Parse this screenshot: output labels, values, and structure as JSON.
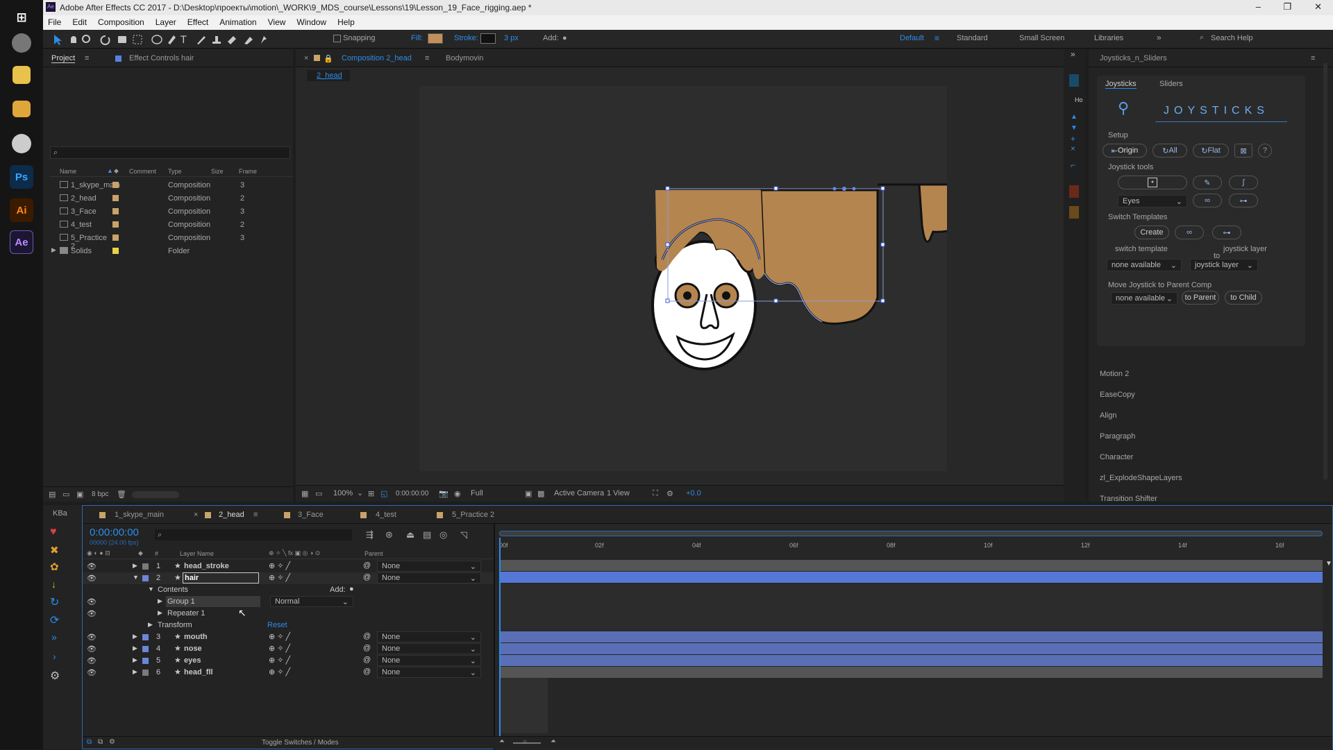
{
  "title_bar": {
    "app_icon": "Ae",
    "title": "Adobe After Effects CC 2017 - D:\\Desktop\\проекты\\motion\\_WORK\\9_MDS_course\\Lessons\\19\\Lesson_19_Face_rigging.aep *",
    "min": "–",
    "max": "❐",
    "close": "✕"
  },
  "menu": [
    "File",
    "Edit",
    "Composition",
    "Layer",
    "Effect",
    "Animation",
    "View",
    "Window",
    "Help"
  ],
  "toolbar": {
    "snapping": "Snapping",
    "fill": "Fill:",
    "fill_color": "#c28f5a",
    "stroke": "Stroke:",
    "stroke_width": "3 px",
    "add": "Add:",
    "workspaces": [
      "Default",
      "Standard",
      "Small Screen",
      "Libraries"
    ],
    "search": "Search Help"
  },
  "taskbar": [
    {
      "icon": "windows-icon",
      "label": ""
    },
    {
      "icon": "ps-icon",
      "label": "Ps"
    },
    {
      "icon": "ai-icon",
      "label": "Ai"
    },
    {
      "icon": "ae-icon",
      "label": "Ae"
    }
  ],
  "project": {
    "tab": "Project",
    "effect_tab": "Effect Controls hair",
    "columns": [
      "Name",
      "Comment",
      "Type",
      "Size",
      "Frame"
    ],
    "items": [
      {
        "name": "1_skype_main",
        "type": "Composition",
        "frame": "3",
        "color": "#c8a36a"
      },
      {
        "name": "2_head",
        "type": "Composition",
        "frame": "2",
        "color": "#c8a36a"
      },
      {
        "name": "3_Face",
        "type": "Composition",
        "frame": "3",
        "color": "#c8a36a"
      },
      {
        "name": "4_test",
        "type": "Composition",
        "frame": "2",
        "color": "#c8a36a"
      },
      {
        "name": "5_Practice 2",
        "type": "Composition",
        "frame": "3",
        "color": "#c8a36a"
      },
      {
        "name": "Solids",
        "type": "Folder",
        "frame": "",
        "color": "#e8d24a"
      }
    ],
    "bpc": "8 bpc"
  },
  "comp": {
    "tab": "Composition 2_head",
    "tab2": "Bodymovin",
    "sub": "2_head",
    "zoom": "100%",
    "time": "0:00:00:00",
    "res": "Full",
    "camera": "Active Camera",
    "view": "1 View",
    "exposure": "+0.0"
  },
  "joysticks": {
    "panel": "Joysticks_n_Sliders",
    "tab1": "Joysticks",
    "tab2": "Sliders",
    "logo": "JOYSTICKS",
    "setup": "Setup",
    "origin": "Origin",
    "all": "All",
    "flat": "Flat",
    "help": "?",
    "tools": "Joystick tools",
    "eyes": "Eyes",
    "switch_templates": "Switch Templates",
    "create": "Create",
    "switch_template": "switch template",
    "to": "to",
    "joystick_layer": "joystick layer",
    "none1": "none available",
    "jl_dd": "joystick layer",
    "move": "Move Joystick to Parent Comp",
    "none2": "none available",
    "to_parent": "to Parent",
    "to_child": "to Child"
  },
  "side_panels": [
    "Motion 2",
    "EaseCopy",
    "Align",
    "Paragraph",
    "Character",
    "zl_ExplodeShapeLayers",
    "Transition Shifter"
  ],
  "timeline": {
    "tabs": [
      "1_skype_main",
      "2_head",
      "3_Face",
      "4_test",
      "5_Practice 2"
    ],
    "kba": "KBa",
    "time": "0:00:00:00",
    "fps": "00000 (24.00 fps)",
    "ticks": [
      "00f",
      "02f",
      "04f",
      "06f",
      "08f",
      "10f",
      "12f",
      "14f",
      "16f"
    ],
    "col_layer": "Layer Name",
    "col_parent": "Parent",
    "col_num": "#",
    "layers": [
      {
        "n": "1",
        "name": "head_stroke",
        "parent": "None",
        "color": "#7a7a7a"
      },
      {
        "n": "2",
        "name": "hair",
        "parent": "None",
        "color": "#6b86d8"
      }
    ],
    "contents": "Contents",
    "add": "Add:",
    "group1": "Group 1",
    "blend": "Normal",
    "repeater": "Repeater 1",
    "transform": "Transform",
    "reset": "Reset",
    "layers2": [
      {
        "n": "3",
        "name": "mouth",
        "parent": "None",
        "color": "#6b86d8"
      },
      {
        "n": "4",
        "name": "nose",
        "parent": "None",
        "color": "#6b86d8"
      },
      {
        "n": "5",
        "name": "eyes",
        "parent": "None",
        "color": "#6b86d8"
      },
      {
        "n": "6",
        "name": "head_fll",
        "parent": "None",
        "color": "#7a7a7a"
      }
    ],
    "toggle": "Toggle Switches / Modes"
  }
}
